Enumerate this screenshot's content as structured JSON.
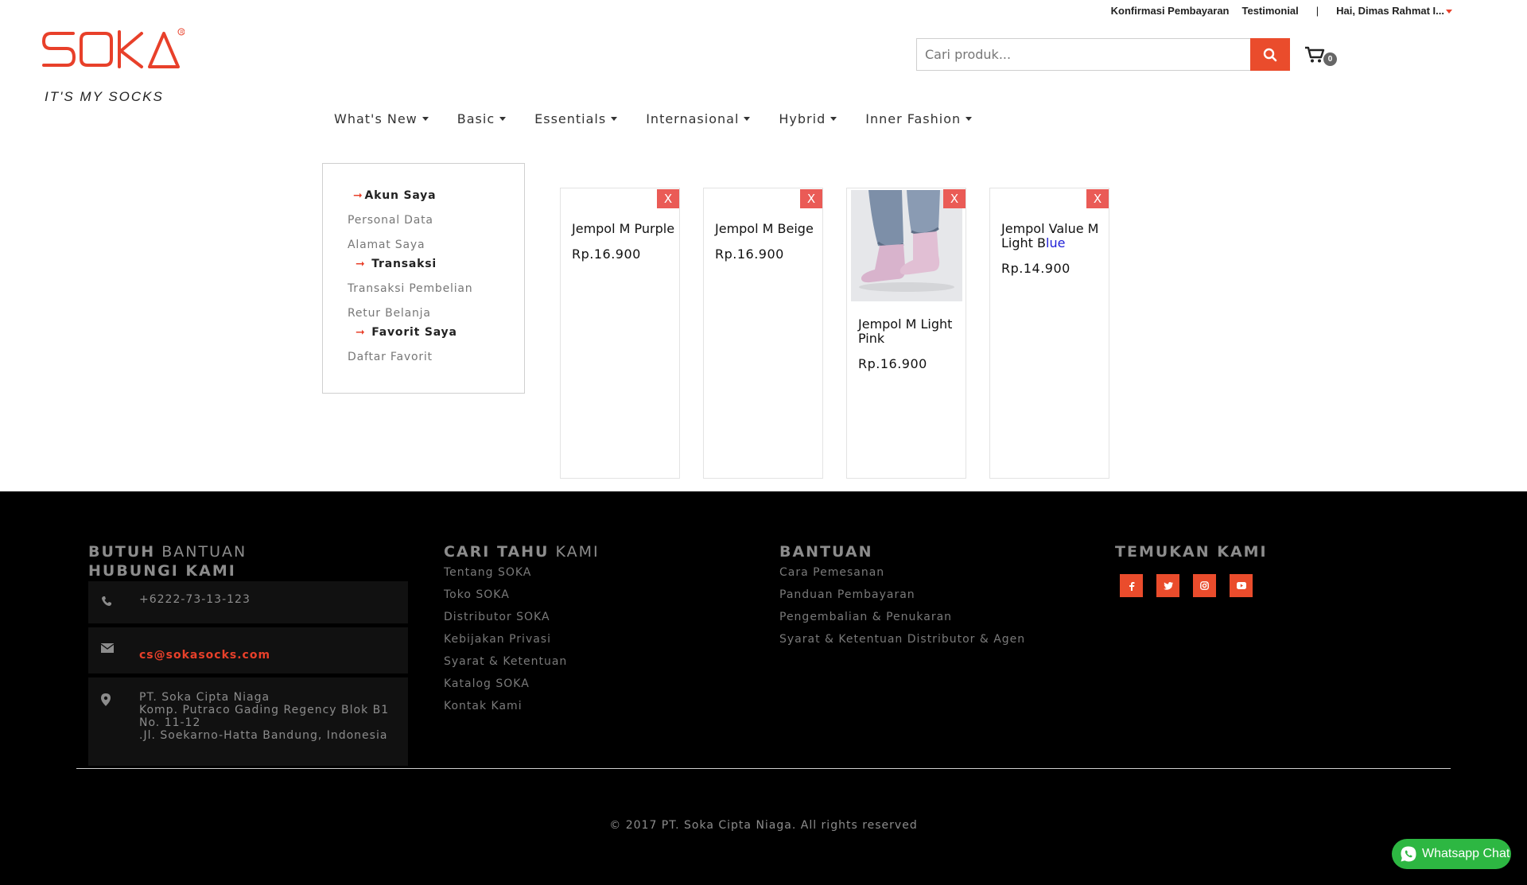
{
  "topbar": {
    "confirm_payment": "Konfirmasi Pembayaran",
    "testimonial": "Testimonial",
    "separator": "|",
    "greeting": "Hai, Dimas Rahmat I..."
  },
  "brand": {
    "name": "SOKA",
    "tagline": "IT'S MY SOCKS",
    "accent": "#e8402a"
  },
  "search": {
    "placeholder": "Cari produk...",
    "icon": "search-icon"
  },
  "cart": {
    "count": "0",
    "icon": "cart-icon"
  },
  "nav": [
    {
      "label": "What's New"
    },
    {
      "label": "Basic"
    },
    {
      "label": "Essentials"
    },
    {
      "label": "Internasional"
    },
    {
      "label": "Hybrid"
    },
    {
      "label": "Inner Fashion"
    }
  ],
  "sidebar": {
    "arrow": "➞",
    "sections": [
      {
        "title": "Akun Saya",
        "items": [
          "Personal Data",
          "Alamat Saya"
        ]
      },
      {
        "title": "Transaksi",
        "items": [
          "Transaksi Pembelian",
          "Retur Belanja"
        ]
      },
      {
        "title": "Favorit Saya",
        "items": [
          "Daftar Favorit"
        ]
      }
    ]
  },
  "favorites": [
    {
      "name": "Jempol M Purple",
      "price": "Rp.16.900",
      "remove": "X",
      "has_image": false
    },
    {
      "name": "Jempol M Beige",
      "price": "Rp.16.900",
      "remove": "X",
      "has_image": false
    },
    {
      "name": "Jempol M Light Pink",
      "price": "Rp.16.900",
      "remove": "X",
      "has_image": true
    },
    {
      "name_main": "Jempol Value M Light B",
      "name_highlight": "lue",
      "price": "Rp.14.900",
      "remove": "X",
      "has_image": false
    }
  ],
  "footer": {
    "contact": {
      "heading_bold": "BUTUH",
      "heading_light": "BANTUAN",
      "heading2": "HUBUNGI KAMI",
      "phone": "+6222-73-13-123",
      "email": "cs@sokasocks.com",
      "address_line1": "PT. Soka Cipta Niaga",
      "address_line2": "Komp. Putraco Gading Regency Blok B1",
      "address_line3": "No. 11-12",
      "address_line4": ".Jl. Soekarno-Hatta Bandung, Indonesia"
    },
    "about": {
      "heading_bold": "CARI TAHU",
      "heading_light": "KAMI",
      "links": [
        "Tentang SOKA",
        "Toko SOKA",
        "Distributor SOKA",
        "Kebijakan Privasi",
        "Syarat & Ketentuan",
        "Katalog SOKA",
        "Kontak Kami"
      ]
    },
    "help": {
      "heading": "BANTUAN",
      "links": [
        "Cara Pemesanan",
        "Panduan Pembayaran",
        "Pengembalian & Penukaran",
        "Syarat & Ketentuan Distributor & Agen"
      ]
    },
    "social": {
      "heading": "TEMUKAN KAMI",
      "icons": [
        "facebook-icon",
        "twitter-icon",
        "instagram-icon",
        "youtube-icon"
      ]
    },
    "copyright": "© 2017 PT. Soka Cipta Niaga. All rights reserved"
  },
  "whatsapp": {
    "label": "Whatsapp Chat",
    "color": "#2db742"
  }
}
